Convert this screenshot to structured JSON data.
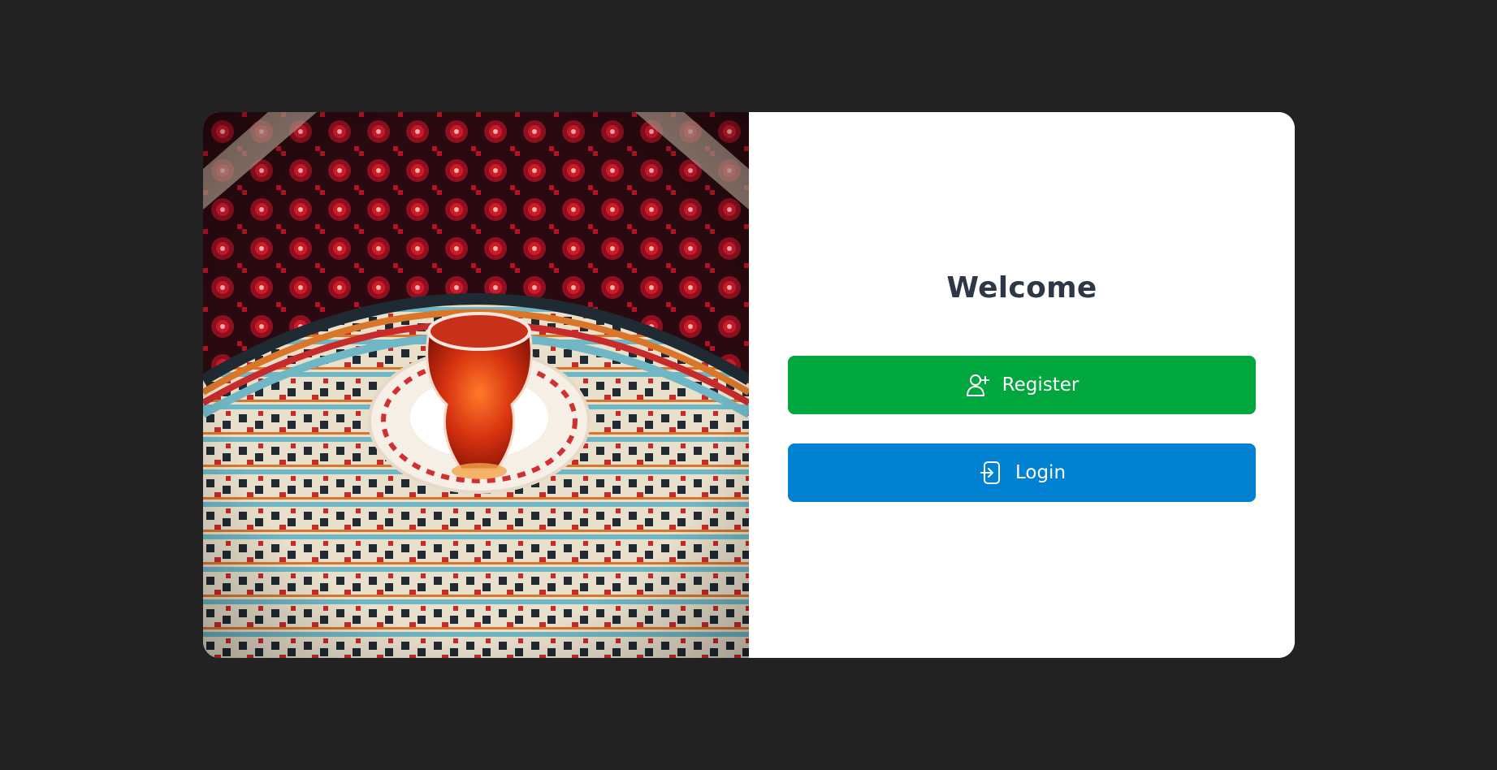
{
  "welcome": {
    "title": "Welcome"
  },
  "buttons": {
    "register": {
      "label": "Register",
      "icon": "user-plus-icon",
      "color": "#00a63e"
    },
    "login": {
      "label": "Login",
      "icon": "login-icon",
      "color": "#0081d1"
    }
  },
  "theme": {
    "background": "#222222",
    "card": "#ffffff",
    "heading": "#2d3748"
  }
}
